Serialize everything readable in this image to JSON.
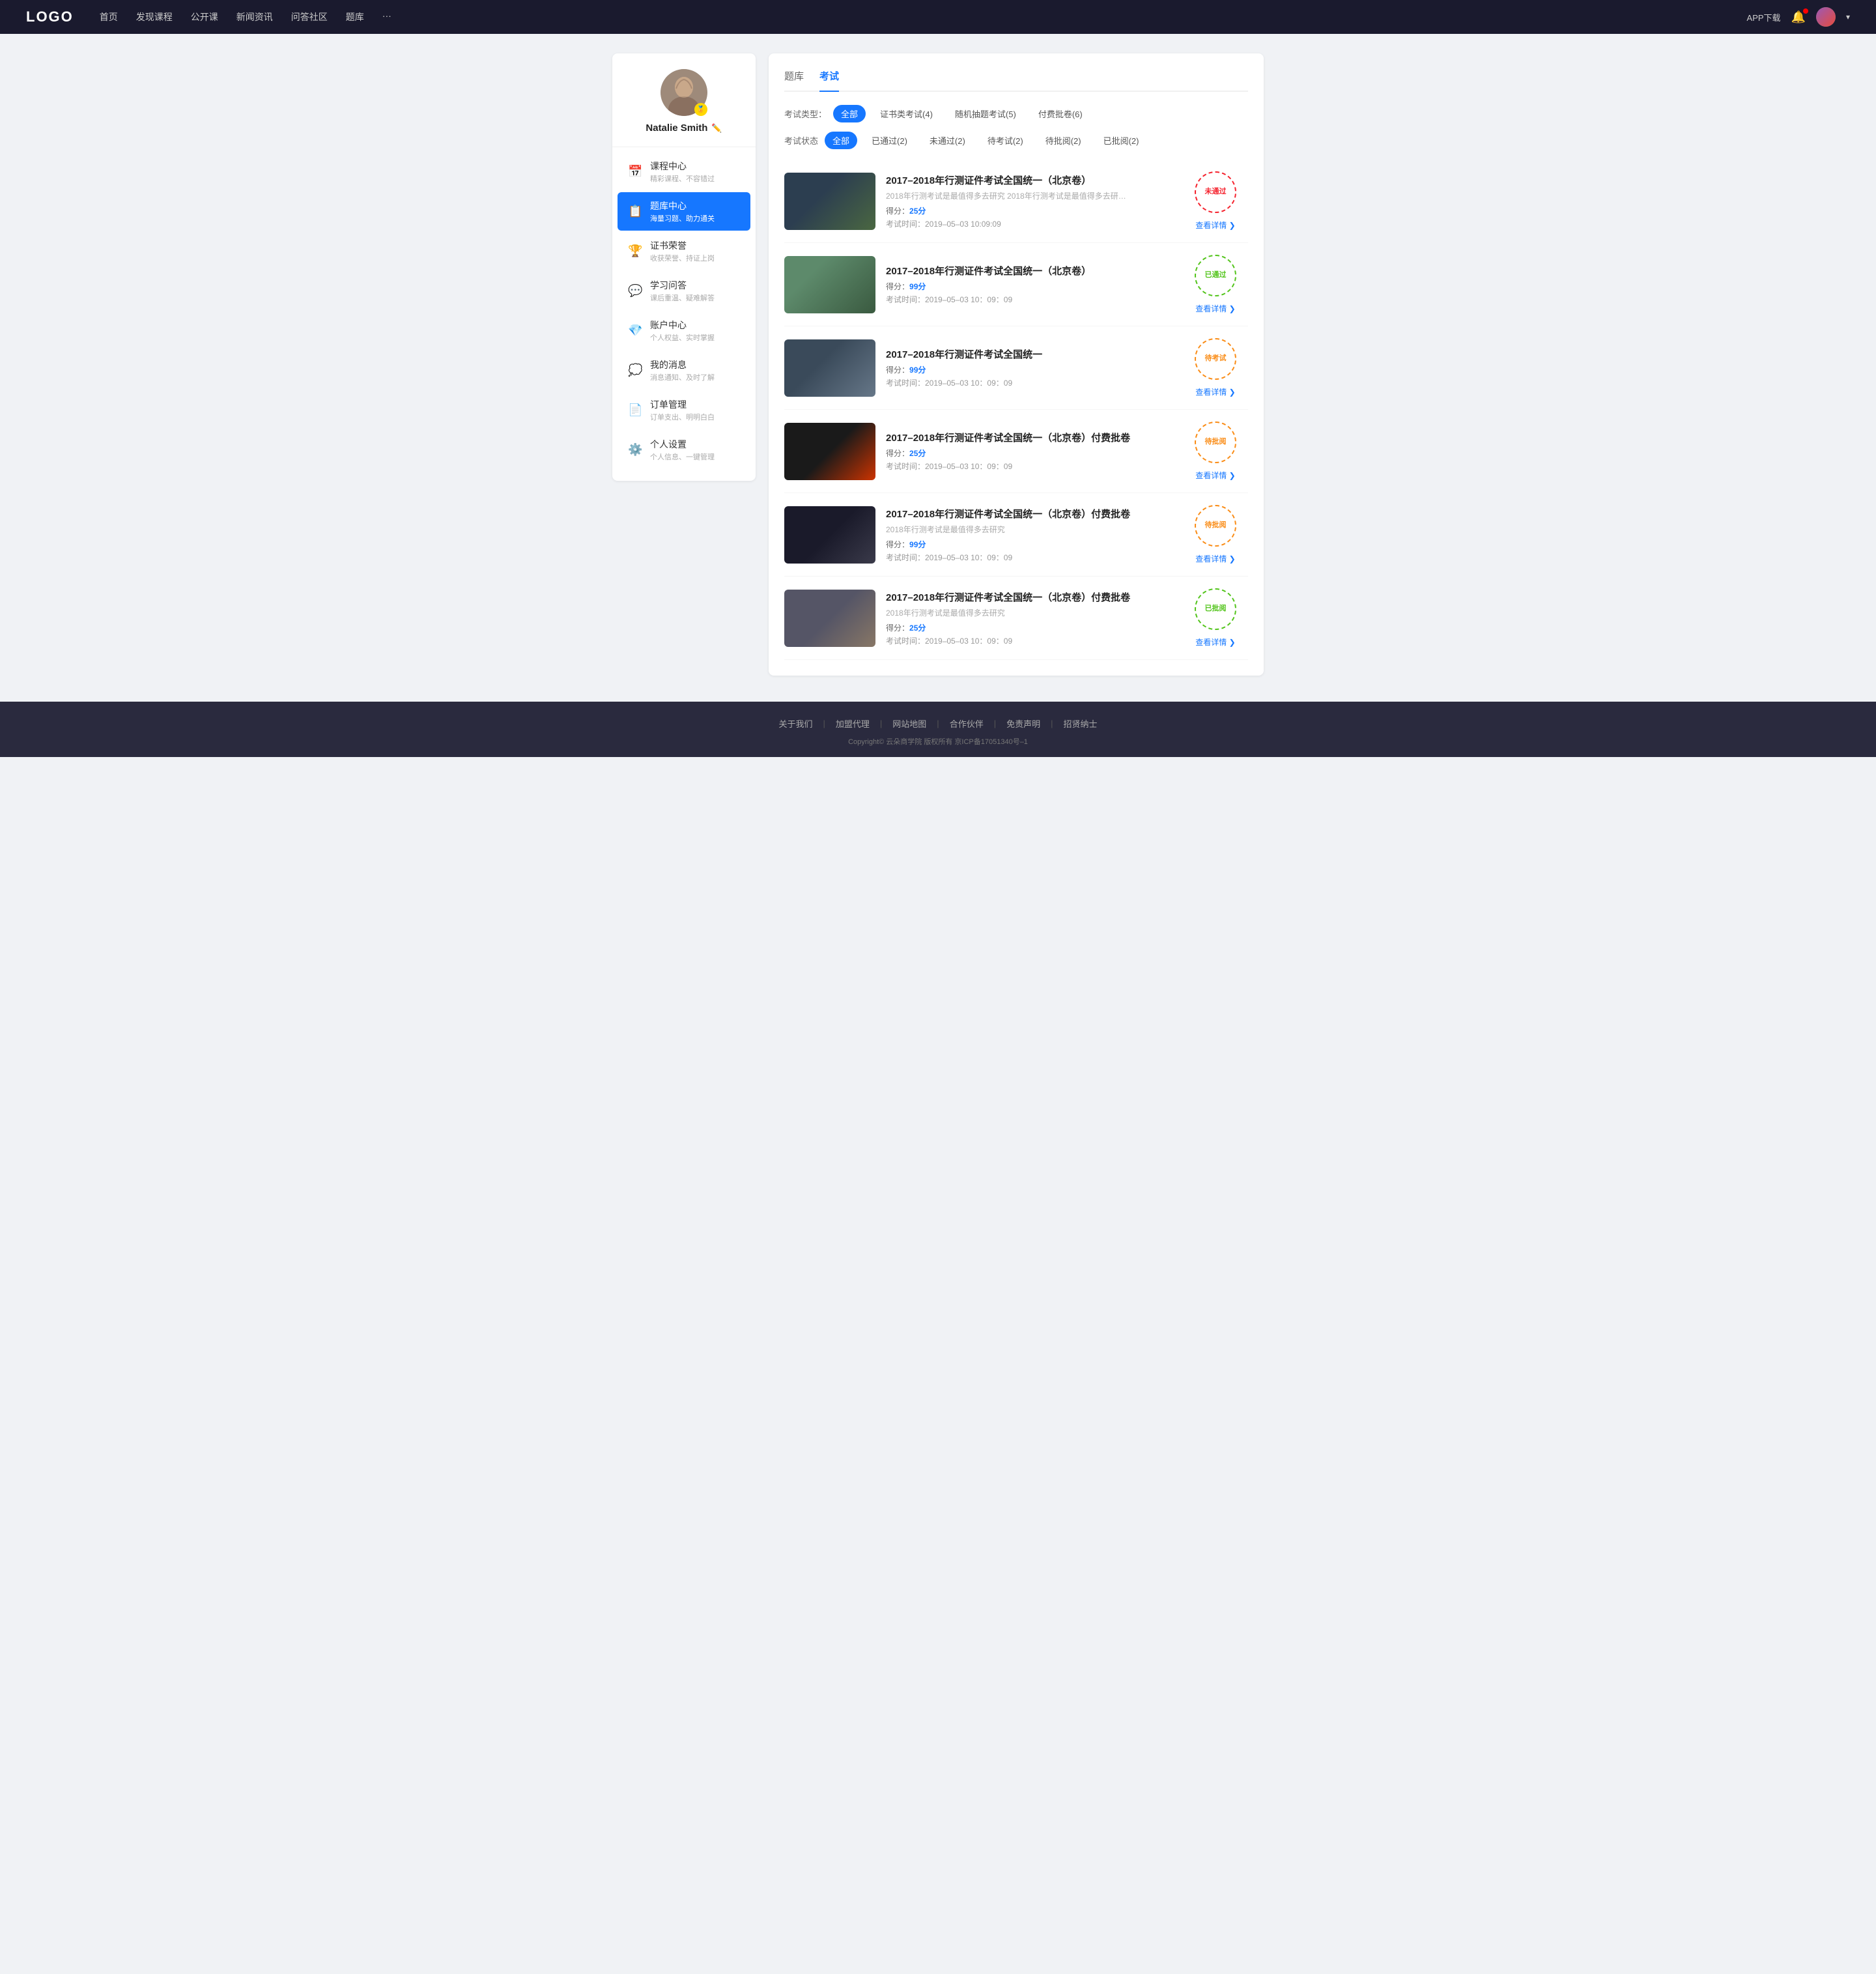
{
  "header": {
    "logo": "LOGO",
    "nav": [
      {
        "label": "首页"
      },
      {
        "label": "发现课程"
      },
      {
        "label": "公开课"
      },
      {
        "label": "新闻资讯"
      },
      {
        "label": "问答社区"
      },
      {
        "label": "题库"
      },
      {
        "label": "···"
      }
    ],
    "app_download": "APP下载",
    "user_name": "Natalie Smith"
  },
  "sidebar": {
    "username": "Natalie Smith",
    "menu_items": [
      {
        "icon": "📅",
        "title": "课程中心",
        "sub": "精彩课程、不容错过",
        "active": false
      },
      {
        "icon": "📋",
        "title": "题库中心",
        "sub": "海量习题、助力通关",
        "active": true
      },
      {
        "icon": "🏆",
        "title": "证书荣誉",
        "sub": "收获荣誉、持证上岗",
        "active": false
      },
      {
        "icon": "💬",
        "title": "学习问答",
        "sub": "课后重温、疑难解答",
        "active": false
      },
      {
        "icon": "💎",
        "title": "账户中心",
        "sub": "个人权益、实时掌握",
        "active": false
      },
      {
        "icon": "💭",
        "title": "我的消息",
        "sub": "消息通知、及时了解",
        "active": false
      },
      {
        "icon": "📄",
        "title": "订单管理",
        "sub": "订单支出、明明白白",
        "active": false
      },
      {
        "icon": "⚙️",
        "title": "个人设置",
        "sub": "个人信息、一键管理",
        "active": false
      }
    ]
  },
  "content": {
    "tabs": [
      {
        "label": "题库"
      },
      {
        "label": "考试",
        "active": true
      }
    ],
    "filter_type": {
      "label": "考试类型：",
      "items": [
        {
          "label": "全部",
          "active": true
        },
        {
          "label": "证书类考试(4)",
          "active": false
        },
        {
          "label": "随机抽题考试(5)",
          "active": false
        },
        {
          "label": "付费批卷(6)",
          "active": false
        }
      ]
    },
    "filter_status": {
      "label": "考试状态",
      "items": [
        {
          "label": "全部",
          "active": true
        },
        {
          "label": "已通过(2)",
          "active": false
        },
        {
          "label": "未通过(2)",
          "active": false
        },
        {
          "label": "待考试(2)",
          "active": false
        },
        {
          "label": "待批阅(2)",
          "active": false
        },
        {
          "label": "已批阅(2)",
          "active": false
        }
      ]
    },
    "exam_items": [
      {
        "thumb_class": "thumb-1",
        "title": "2017–2018年行测证件考试全国统一（北京卷）",
        "desc": "2018年行测考试是最值得多去研究 2018年行测考试是最值得多去研究 2018年行…",
        "score_label": "得分：",
        "score": "25分",
        "time_label": "考试时间：",
        "time": "2019–05–03  10:09:09",
        "stamp_text": "未通过",
        "stamp_class": "stamp-fail",
        "detail_label": "查看详情"
      },
      {
        "thumb_class": "thumb-2",
        "title": "2017–2018年行测证件考试全国统一（北京卷）",
        "desc": "",
        "score_label": "得分：",
        "score": "99分",
        "time_label": "考试时间：",
        "time": "2019–05–03  10：09：09",
        "stamp_text": "已通过",
        "stamp_class": "stamp-pass",
        "detail_label": "查看详情"
      },
      {
        "thumb_class": "thumb-3",
        "title": "2017–2018年行测证件考试全国统一",
        "desc": "",
        "score_label": "得分：",
        "score": "99分",
        "time_label": "考试时间：",
        "time": "2019–05–03  10：09：09",
        "stamp_text": "待考试",
        "stamp_class": "stamp-pending",
        "detail_label": "查看详情"
      },
      {
        "thumb_class": "thumb-4",
        "title": "2017–2018年行测证件考试全国统一（北京卷）付费批卷",
        "desc": "",
        "score_label": "得分：",
        "score": "25分",
        "time_label": "考试时间：",
        "time": "2019–05–03  10：09：09",
        "stamp_text": "待批阅",
        "stamp_class": "stamp-review",
        "detail_label": "查看详情"
      },
      {
        "thumb_class": "thumb-5",
        "title": "2017–2018年行测证件考试全国统一（北京卷）付费批卷",
        "desc": "2018年行测考试是最值得多去研究",
        "score_label": "得分：",
        "score": "99分",
        "time_label": "考试时间：",
        "time": "2019–05–03  10：09：09",
        "stamp_text": "待批阅",
        "stamp_class": "stamp-review",
        "detail_label": "查看详情"
      },
      {
        "thumb_class": "thumb-6",
        "title": "2017–2018年行测证件考试全国统一（北京卷）付费批卷",
        "desc": "2018年行测考试是最值得多去研究",
        "score_label": "得分：",
        "score": "25分",
        "time_label": "考试时间：",
        "time": "2019–05–03  10：09：09",
        "stamp_text": "已批阅",
        "stamp_class": "stamp-reviewed",
        "detail_label": "查看详情"
      }
    ]
  },
  "footer": {
    "links": [
      {
        "label": "关于我们"
      },
      {
        "label": "加盟代理"
      },
      {
        "label": "网站地图"
      },
      {
        "label": "合作伙伴"
      },
      {
        "label": "免责声明"
      },
      {
        "label": "招贤纳士"
      }
    ],
    "copyright": "Copyright© 云朵商学院  版权所有    京ICP备17051340号–1"
  }
}
